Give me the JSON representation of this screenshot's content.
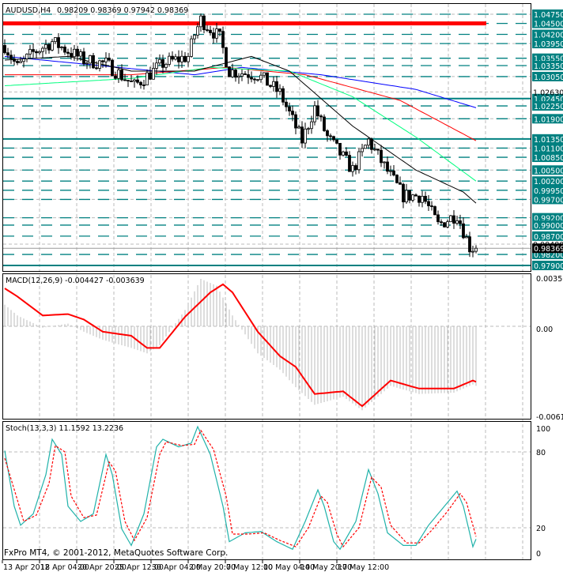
{
  "header": {
    "symbol_tf": "AUDUSD,H4",
    "ohlc": "0.98209 0.98369 0.97942 0.98369"
  },
  "macd": {
    "label": "MACD(12,26,9) -0.004427 -0.003639",
    "axis": [
      "0.003569",
      "0.00",
      "-0.00616"
    ],
    "max": 0.00356,
    "min": -0.00616
  },
  "stoch": {
    "label": "Stoch(13,3,3) 11.1592 13.2236",
    "axis": [
      "100",
      "80",
      "20",
      "0"
    ]
  },
  "footer": {
    "copyright": "FxPro MT4, © 2001-2012, MetaQuotes Software Corp."
  },
  "time_axis": [
    "13 Apr 2012",
    "18 Apr 04:00",
    "20 Apr 20:00",
    "25 Apr 12:00",
    "30 Apr 04:00",
    "2 May 20:00",
    "7 May 12:00",
    "10 May 04:00",
    "14 May 20:00",
    "17 May 12:00"
  ],
  "colors": {
    "level": "#008080",
    "resistance": "#ff0000",
    "bull": "#ffffff",
    "bear": "#000000",
    "ma_blue": "#0000ff",
    "ma_red": "#ff0000",
    "ma_green": "#00ff7f",
    "ma_black": "#000000",
    "stoch_main": "#20b2aa",
    "stoch_signal": "#ff0000"
  },
  "chart_data": {
    "type": "candlestick",
    "symbol": "AUDUSD",
    "timeframe": "H4",
    "price_range": [
      0.9781,
      1.049
    ],
    "price_levels": [
      "1.04750",
      "1.04500",
      "1.04200",
      "1.03950",
      "1.03550",
      "1.03350",
      "1.03050",
      "1.02450",
      "1.02250",
      "1.01900",
      "1.01350",
      "1.01100",
      "1.00850",
      "1.00500",
      "1.00200",
      "0.99950",
      "0.99700",
      "0.99200",
      "0.99000",
      "0.98700",
      "0.98200",
      "0.97900"
    ],
    "price_tags": {
      "top": "1.02630",
      "mid": "0.98480",
      "current": "0.98369"
    },
    "solid_levels": [
      1.0245,
      1.0135,
      0.979
    ],
    "resistance": 1.045,
    "close_anchors": [
      [
        0,
        1.039
      ],
      [
        4,
        1.033
      ],
      [
        9,
        1.037
      ],
      [
        15,
        1.04
      ],
      [
        25,
        1.035
      ],
      [
        32,
        1.034
      ],
      [
        41,
        1.028
      ],
      [
        50,
        1.034
      ],
      [
        58,
        1.036
      ],
      [
        60,
        1.042
      ],
      [
        62,
        1.046
      ],
      [
        68,
        1.041
      ],
      [
        71,
        1.032
      ],
      [
        80,
        1.031
      ],
      [
        87,
        1.026
      ],
      [
        94,
        1.013
      ],
      [
        98,
        1.022
      ],
      [
        102,
        1.014
      ],
      [
        110,
        1.005
      ],
      [
        115,
        1.013
      ],
      [
        120,
        1.006
      ],
      [
        126,
        0.998
      ],
      [
        132,
        0.998
      ],
      [
        137,
        0.99
      ],
      [
        143,
        0.993
      ],
      [
        147,
        0.984
      ],
      [
        149,
        0.9837
      ]
    ],
    "ma": {
      "blue": [
        [
          0,
          1.036
        ],
        [
          60,
          1.031
        ],
        [
          75,
          1.033
        ],
        [
          100,
          1.031
        ],
        [
          130,
          1.027
        ],
        [
          149,
          1.022
        ]
      ],
      "red": [
        [
          0,
          1.031
        ],
        [
          40,
          1.031
        ],
        [
          70,
          1.033
        ],
        [
          95,
          1.031
        ],
        [
          125,
          1.024
        ],
        [
          149,
          1.013
        ]
      ],
      "green": [
        [
          0,
          1.028
        ],
        [
          40,
          1.03
        ],
        [
          65,
          1.033
        ],
        [
          90,
          1.032
        ],
        [
          110,
          1.025
        ],
        [
          130,
          1.014
        ],
        [
          149,
          1.002
        ]
      ],
      "black": [
        [
          0,
          1.035
        ],
        [
          20,
          1.036
        ],
        [
          40,
          1.032
        ],
        [
          60,
          1.032
        ],
        [
          78,
          1.036
        ],
        [
          90,
          1.032
        ],
        [
          110,
          1.017
        ],
        [
          130,
          1.005
        ],
        [
          145,
          0.999
        ],
        [
          149,
          0.996
        ]
      ]
    },
    "macd_signal": [
      [
        0,
        0.0028
      ],
      [
        4,
        0.0022
      ],
      [
        12,
        0.0008
      ],
      [
        20,
        0.0009
      ],
      [
        25,
        0.0005
      ],
      [
        31,
        -0.0004
      ],
      [
        40,
        -0.0007
      ],
      [
        45,
        -0.0016
      ],
      [
        49,
        -0.0016
      ],
      [
        57,
        0.0007
      ],
      [
        65,
        0.0025
      ],
      [
        69,
        0.0031
      ],
      [
        72,
        0.0025
      ],
      [
        80,
        -0.0004
      ],
      [
        87,
        -0.0022
      ],
      [
        92,
        -0.003
      ],
      [
        98,
        -0.005
      ],
      [
        107,
        -0.0048
      ],
      [
        113,
        -0.0059
      ],
      [
        122,
        -0.004
      ],
      [
        131,
        -0.0046
      ],
      [
        142,
        -0.0046
      ],
      [
        148,
        -0.004
      ],
      [
        149,
        -0.0041
      ]
    ],
    "macd_hist": [
      [
        0,
        0.0016
      ],
      [
        4,
        0.0008
      ],
      [
        12,
        -0.0001
      ],
      [
        20,
        0.0002
      ],
      [
        25,
        -0.0004
      ],
      [
        31,
        -0.001
      ],
      [
        40,
        -0.0016
      ],
      [
        45,
        -0.002
      ],
      [
        49,
        -0.0014
      ],
      [
        57,
        0.0012
      ],
      [
        62,
        0.0035
      ],
      [
        67,
        0.003
      ],
      [
        72,
        0.0008
      ],
      [
        80,
        -0.002
      ],
      [
        87,
        -0.0032
      ],
      [
        92,
        -0.0045
      ],
      [
        98,
        -0.0058
      ],
      [
        107,
        -0.0052
      ],
      [
        113,
        -0.0062
      ],
      [
        122,
        -0.0044
      ],
      [
        131,
        -0.005
      ],
      [
        142,
        -0.0049
      ],
      [
        148,
        -0.0043
      ],
      [
        149,
        -0.0044
      ]
    ],
    "stoch_main": [
      [
        0,
        81
      ],
      [
        3,
        37
      ],
      [
        5,
        22
      ],
      [
        9,
        31
      ],
      [
        13,
        62
      ],
      [
        15,
        90
      ],
      [
        18,
        78
      ],
      [
        20,
        37
      ],
      [
        24,
        25
      ],
      [
        28,
        31
      ],
      [
        32,
        78
      ],
      [
        34,
        62
      ],
      [
        37,
        19
      ],
      [
        40,
        6
      ],
      [
        44,
        31
      ],
      [
        48,
        84
      ],
      [
        50,
        90
      ],
      [
        55,
        84
      ],
      [
        59,
        87
      ],
      [
        61,
        100
      ],
      [
        65,
        78
      ],
      [
        69,
        37
      ],
      [
        71,
        9
      ],
      [
        76,
        16
      ],
      [
        81,
        17
      ],
      [
        86,
        9
      ],
      [
        91,
        3
      ],
      [
        95,
        25
      ],
      [
        99,
        50
      ],
      [
        101,
        37
      ],
      [
        104,
        9
      ],
      [
        106,
        3
      ],
      [
        111,
        25
      ],
      [
        115,
        66
      ],
      [
        118,
        47
      ],
      [
        121,
        16
      ],
      [
        126,
        6
      ],
      [
        130,
        6
      ],
      [
        134,
        22
      ],
      [
        139,
        37
      ],
      [
        143,
        49
      ],
      [
        145,
        37
      ],
      [
        148,
        5
      ],
      [
        149,
        11
      ]
    ],
    "stoch_signal": [
      [
        0,
        75
      ],
      [
        4,
        42
      ],
      [
        6,
        25
      ],
      [
        10,
        30
      ],
      [
        14,
        55
      ],
      [
        16,
        85
      ],
      [
        19,
        80
      ],
      [
        21,
        45
      ],
      [
        25,
        28
      ],
      [
        29,
        30
      ],
      [
        33,
        72
      ],
      [
        35,
        65
      ],
      [
        38,
        25
      ],
      [
        41,
        10
      ],
      [
        45,
        28
      ],
      [
        49,
        78
      ],
      [
        51,
        88
      ],
      [
        56,
        85
      ],
      [
        60,
        86
      ],
      [
        62,
        97
      ],
      [
        66,
        82
      ],
      [
        70,
        45
      ],
      [
        72,
        15
      ],
      [
        77,
        15
      ],
      [
        82,
        16
      ],
      [
        87,
        10
      ],
      [
        92,
        5
      ],
      [
        96,
        20
      ],
      [
        100,
        45
      ],
      [
        102,
        40
      ],
      [
        105,
        15
      ],
      [
        107,
        5
      ],
      [
        112,
        20
      ],
      [
        116,
        60
      ],
      [
        119,
        52
      ],
      [
        122,
        22
      ],
      [
        127,
        8
      ],
      [
        131,
        8
      ],
      [
        135,
        18
      ],
      [
        140,
        33
      ],
      [
        144,
        47
      ],
      [
        146,
        40
      ],
      [
        149,
        13
      ]
    ]
  }
}
